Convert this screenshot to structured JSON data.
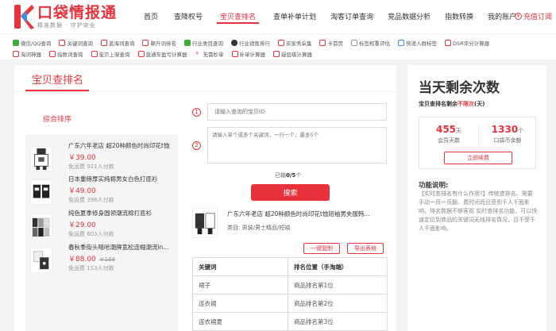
{
  "brand": {
    "title": "口袋情报通",
    "slogan": "精准数据 · 守护安全"
  },
  "nav": [
    {
      "label": "首页"
    },
    {
      "label": "查降权号"
    },
    {
      "label": "宝贝查排名",
      "active": true
    },
    {
      "label": "查单补单计划"
    },
    {
      "label": "淘客订单查询"
    },
    {
      "label": "竞品数据分析"
    },
    {
      "label": "指数转换"
    },
    {
      "label": "我的账户"
    }
  ],
  "recharge_label": "充值订阅",
  "tools_row1": [
    {
      "label": "微信/QQ查询",
      "icon": "wechat-icon",
      "color": "#3cb034"
    },
    {
      "label": "关键词查询",
      "icon": "keyword-icon",
      "color": "#e8333d"
    },
    {
      "label": "蓝海词查询",
      "icon": "blue-ocean-icon",
      "color": "#e8333d"
    },
    {
      "label": "飙升词排名",
      "icon": "rising-icon",
      "color": "#e8333d"
    },
    {
      "label": "行业类目查询",
      "icon": "industry-icon",
      "color": "#3cb034"
    },
    {
      "label": "行业销售排行",
      "icon": "ranking-icon",
      "color": "#333333"
    },
    {
      "label": "买家秀采集",
      "icon": "collect-icon",
      "color": "#e8333d"
    },
    {
      "label": "卡首页",
      "icon": "home-icon",
      "color": "#e8333d"
    },
    {
      "label": "标签权重评估",
      "icon": "tag-icon",
      "color": "#999999"
    },
    {
      "label": "快递人群标签",
      "icon": "express-icon",
      "color": "#3a8ee6"
    },
    {
      "label": "DSR评分计算器",
      "icon": "dsr-icon",
      "color": "#e8333d"
    }
  ],
  "tools_row2": [
    {
      "label": "淘词神器",
      "icon": "word-tool-icon",
      "color": "#e8333d"
    },
    {
      "label": "指数词查询",
      "icon": "index-word-icon",
      "color": "#e8333d"
    },
    {
      "label": "宝贝上架查询",
      "icon": "listing-icon",
      "color": "#e8333d"
    },
    {
      "label": "直通车盈亏计算器",
      "icon": "calculator-icon",
      "color": "#e8333d"
    },
    {
      "label": "无需秒单",
      "icon": "lightning-icon",
      "color": "#e8333d"
    },
    {
      "label": "补单计算器",
      "icon": "order-calc-icon",
      "color": "#e8333d"
    },
    {
      "label": "疑层级计算器",
      "icon": "level-calc-icon",
      "color": "#e8333d"
    }
  ],
  "main": {
    "title": "宝贝查排名",
    "sort_label": "综合排序",
    "items": [
      {
        "title": "广东六年老店 超20种颜色时尚印花t恤",
        "price": "￥39.00",
        "original": "",
        "shipping": "免运费",
        "sold": "921人付款"
      },
      {
        "title": "日本重磅厚实纯棉男女白色打底衫",
        "price": "￥49.00",
        "original": "",
        "shipping": "免运费",
        "sold": "396人付款"
      },
      {
        "title": "纯色夏季修身圆领潮流棉打底衫",
        "price": "￥29.00",
        "original": "",
        "shipping": "免运费",
        "sold": "603人付款"
      },
      {
        "title": "春秋季街头嘻哈潮牌宽松连帽潮流in...",
        "price": "￥88.00",
        "original": "￥168",
        "shipping": "免运费",
        "sold": "153人付款"
      }
    ],
    "form": {
      "id_placeholder": "请输入查询的宝贝ID",
      "keywords_placeholder": "请输入单个或多个关键词，一行一个，最多5个",
      "count_prefix": "已输",
      "count_value": "0/5",
      "count_suffix": "个",
      "search_label": "搜索"
    },
    "result": {
      "title": "广东六年老店 超20种颜色时尚印花t恤短袖男夹服韩...",
      "category": "类目: 男装/男士精品/短袖",
      "copy_label": "一键复制",
      "export_label": "导出表格"
    },
    "table": {
      "headers": [
        "关键词",
        "排名位置（手淘端）"
      ],
      "rows": [
        [
          "裙子",
          "商品排名第1位"
        ],
        [
          "连衣裙",
          "商品排名第2位"
        ],
        [
          "连衣裙夏",
          "商品排名第3位"
        ]
      ]
    }
  },
  "side": {
    "title": "当天剩余次数",
    "sub_prefix": "宝贝查排名剩余",
    "sub_highlight": "不限次",
    "sub_suffix": "(天)",
    "stat1_value": "455",
    "stat1_unit": "天",
    "stat1_label": "会员天数",
    "stat2_value": "1330",
    "stat2_unit": "个",
    "stat2_label": "口袋币余额",
    "renew_label": "立即续费",
    "func_title": "功能说明:",
    "func_desc": "【实时查排名有什么作用?】传统查排名、需要手动一页一页翻、费时间而且受到千人千面影响，排名数据不够客观 实时查排名功能，可以快速定位到商品的关键词无线排名情况，且不受千人千面影响。"
  }
}
